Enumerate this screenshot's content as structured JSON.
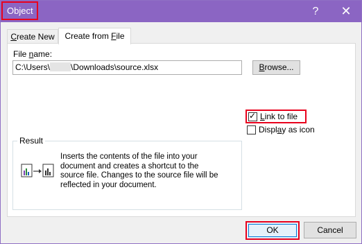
{
  "window": {
    "title": "Object",
    "help_glyph": "?",
    "close_glyph": "✕"
  },
  "tabs": [
    {
      "label_prefix": "C",
      "label_rest": "reate New",
      "selected": false
    },
    {
      "label_prefix": "Create from ",
      "label_key": "F",
      "label_rest": "ile",
      "selected": true
    }
  ],
  "file": {
    "label_prefix": "File ",
    "label_key": "n",
    "label_rest": "ame:",
    "value_start": "C:\\Users\\",
    "value_end": "\\Downloads\\source.xlsx",
    "browse_key": "B",
    "browse_rest": "rowse..."
  },
  "options": {
    "link_key": "L",
    "link_rest": "ink to file",
    "link_checked": true,
    "icon_prefix": "Displ",
    "icon_key": "a",
    "icon_rest": "y as icon",
    "icon_checked": false
  },
  "result": {
    "legend": "Result",
    "text": "Inserts the contents of the file into your document and creates a shortcut to the source file.  Changes to the source file will be reflected in your document."
  },
  "buttons": {
    "ok": "OK",
    "cancel": "Cancel"
  },
  "colors": {
    "titlebar": "#8b65c3",
    "highlight": "#e8001c",
    "focus": "#0078d7"
  }
}
